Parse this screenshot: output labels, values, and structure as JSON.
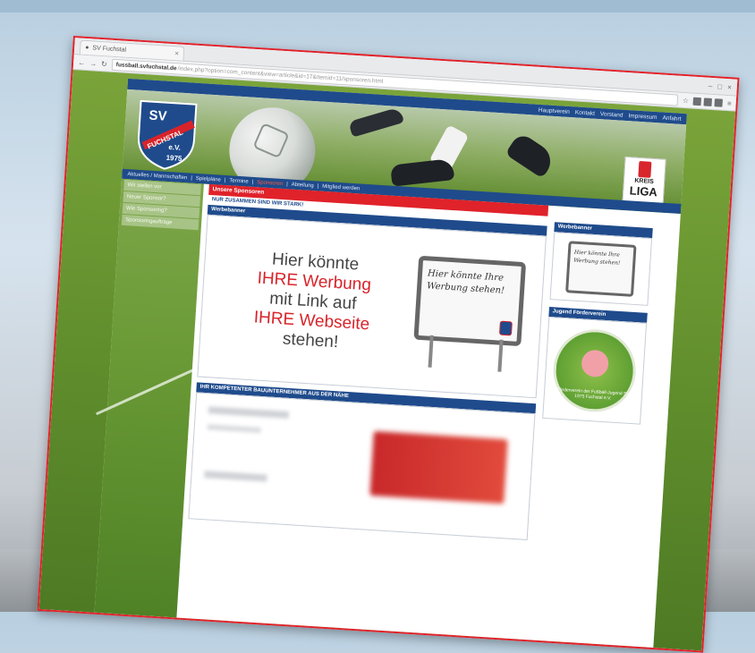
{
  "browser": {
    "tab_title": "SV Fuchstal",
    "url_host": "fussball.svfuchstal.de",
    "url_path": "/index.php?option=com_content&view=article&id=17&Itemid=11/sponsoren.html"
  },
  "site": {
    "topnav": [
      "Hauptverein",
      "Kontakt",
      "Vorstand",
      "Impressum",
      "Anfahrt"
    ],
    "club_logo": {
      "line1": "SV",
      "line2": "FUCHSTAL",
      "line3": "e.V.",
      "year": "1975"
    },
    "liga_badge": {
      "line1": "KREIS",
      "line2": "LIGA"
    },
    "mainnav": [
      "Aktuelles / Mannschaften",
      "Spielpläne",
      "Termine",
      "Sponsoren",
      "Abteilung",
      "Mitglied werden"
    ],
    "mainnav_active": "Sponsoren",
    "sidebar": [
      "Wir stellen vor",
      "Neuer Sponsor?",
      "Wie Sponsoring?",
      "Sponsoringaufträge"
    ],
    "content": {
      "section_title": "Unsere Sponsoren",
      "slogan": "NUR ZUSAMMEN SIND WIR STARK!",
      "ad_header": "Werbebanner",
      "ad_lines": [
        "Hier könnte",
        "IHRE Werbung",
        "mit Link auf",
        "IHRE Webseite",
        "stehen!"
      ],
      "sign_text": "Hier könnte Ihre Werbung stehen!",
      "builders_header": "IHR KOMPETENTER BAUUNTERNEHMER AUS DER NÄHE"
    },
    "right": {
      "box1_header": "Werbebanner",
      "box1_sign_text": "Hier könnte Ihre Werbung stehen!",
      "box2_header": "Jugend Förderverein",
      "box2_emblem": "Förderverein der Fußball-Jugend SV 1975 Fuchstal e.V."
    }
  }
}
